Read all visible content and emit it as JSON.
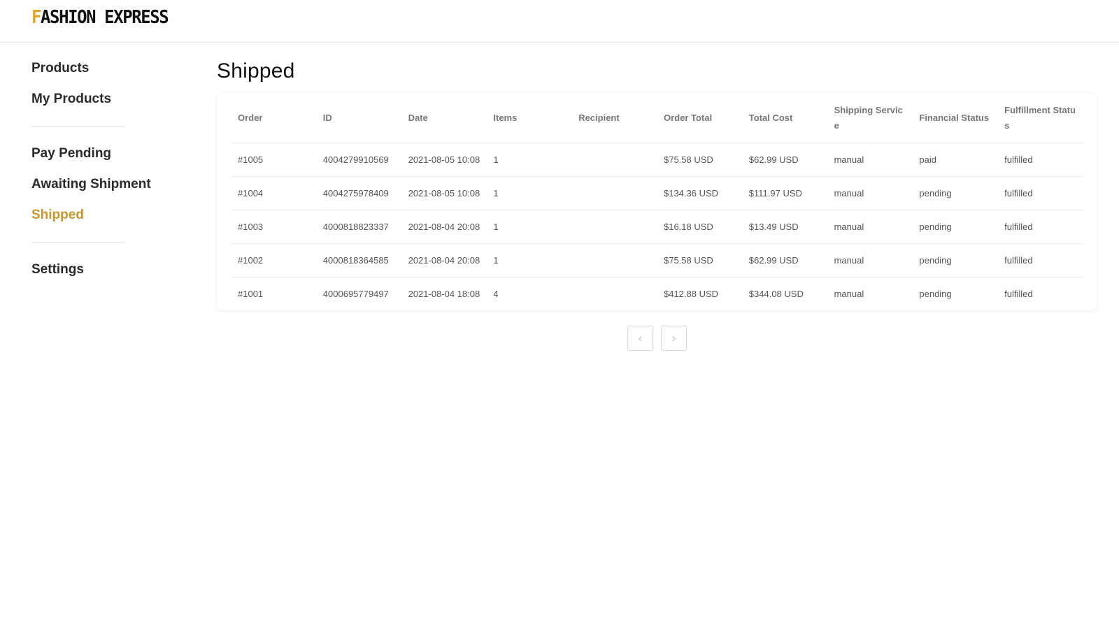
{
  "brand": {
    "logo_first": "F",
    "logo_rest": "ASHION EXPRESS",
    "accent_color": "#e8a224"
  },
  "sidebar": {
    "group1": [
      {
        "label": "Products"
      },
      {
        "label": "My Products"
      }
    ],
    "group2": [
      {
        "label": "Pay Pending"
      },
      {
        "label": "Awaiting Shipment"
      },
      {
        "label": "Shipped",
        "active": true
      }
    ],
    "group3": [
      {
        "label": "Settings"
      }
    ],
    "active_color": "#c9962c"
  },
  "main": {
    "title": "Shipped",
    "table": {
      "columns": [
        "Order",
        "ID",
        "Date",
        "Items",
        "Recipient",
        "Order Total",
        "Total Cost",
        "Shipping Service",
        "Financial Status",
        "Fulfillment Status"
      ],
      "rows": [
        [
          "#1005",
          "4004279910569",
          "2021-08-05 10:08",
          "1",
          "",
          "$75.58 USD",
          "$62.99 USD",
          "manual",
          "paid",
          "fulfilled"
        ],
        [
          "#1004",
          "4004275978409",
          "2021-08-05 10:08",
          "1",
          "",
          "$134.36 USD",
          "$111.97 USD",
          "manual",
          "pending",
          "fulfilled"
        ],
        [
          "#1003",
          "4000818823337",
          "2021-08-04 20:08",
          "1",
          "",
          "$16.18 USD",
          "$13.49 USD",
          "manual",
          "pending",
          "fulfilled"
        ],
        [
          "#1002",
          "4000818364585",
          "2021-08-04 20:08",
          "1",
          "",
          "$75.58 USD",
          "$62.99 USD",
          "manual",
          "pending",
          "fulfilled"
        ],
        [
          "#1001",
          "4000695779497",
          "2021-08-04 18:08",
          "4",
          "",
          "$412.88 USD",
          "$344.08 USD",
          "manual",
          "pending",
          "fulfilled"
        ]
      ]
    },
    "pagination": {
      "prev_icon": "chevron-left-icon",
      "prev_glyph": "‹",
      "next_icon": "chevron-right-icon",
      "next_glyph": "›"
    }
  }
}
